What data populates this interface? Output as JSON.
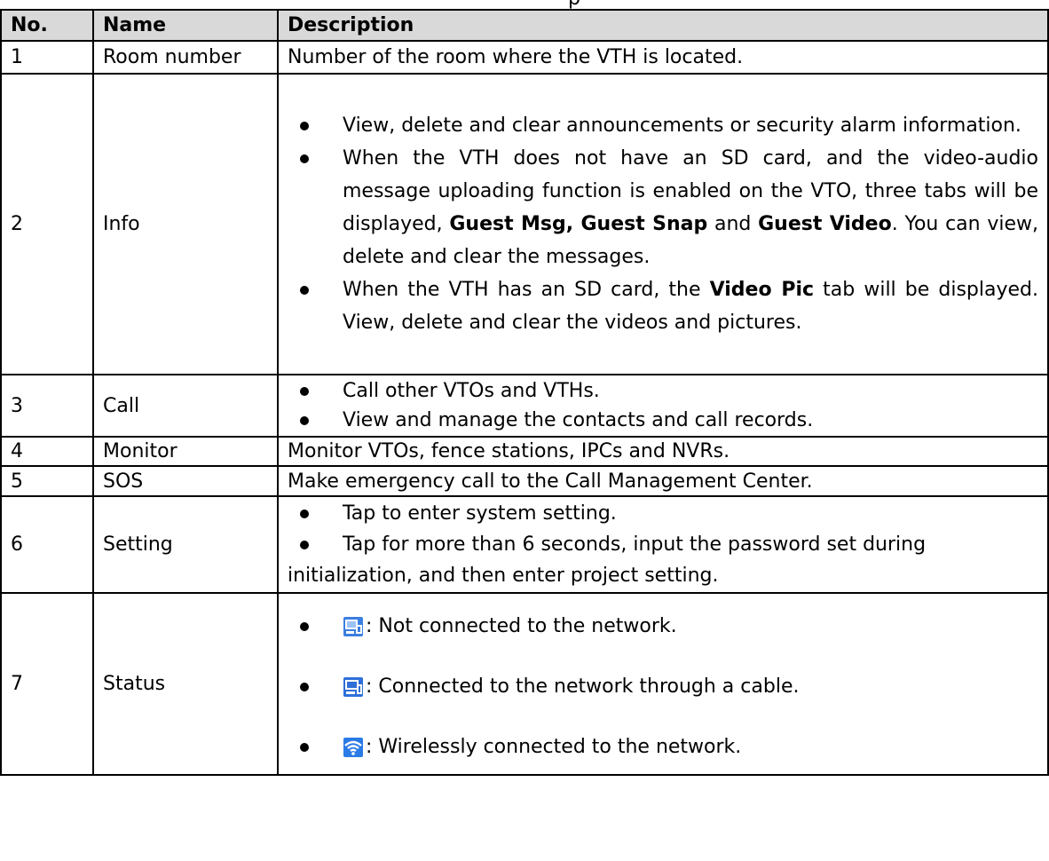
{
  "top_fragment": "p",
  "table": {
    "headers": [
      "No.",
      "Name",
      "Description"
    ],
    "rows": [
      {
        "no": "1",
        "name": "Room number",
        "desc": "Number of the room where the VTH is located."
      },
      {
        "no": "2",
        "name": "Info",
        "bullets": [
          "View, delete and clear announcements or security alarm information.",
          "When the VTH does not have an SD card, and the video-audio message uploading function is enabled on the VTO, three tabs will be displayed, ",
          "When the VTH has an SD card, the "
        ],
        "bold": {
          "guest_msg_snap": "Guest Msg, Guest Snap",
          "and": " and ",
          "guest_video": "Guest Video",
          "after_video": ". You can view, delete and clear the messages.",
          "video_pic": "Video Pic",
          "after_video_pic": " tab will be displayed. View, delete and clear the videos and pictures."
        }
      },
      {
        "no": "3",
        "name": "Call",
        "bullets": [
          "Call other VTOs and VTHs.",
          "View and manage the contacts and call records."
        ]
      },
      {
        "no": "4",
        "name": "Monitor",
        "desc": "Monitor VTOs, fence stations, IPCs and NVRs."
      },
      {
        "no": "5",
        "name": "SOS",
        "desc": "Make emergency call to the Call Management Center."
      },
      {
        "no": "6",
        "name": "Setting",
        "bullet1": "Tap to enter system setting.",
        "bullet2_part1": "Tap for more than 6 seconds, input the password set during",
        "bullet2_part2": "initialization, and then enter project setting."
      },
      {
        "no": "7",
        "name": "Status",
        "status": [
          {
            "icon": "network-disconnected-icon",
            "text": ": Not connected to the network."
          },
          {
            "icon": "network-cable-icon",
            "text": ": Connected to the network through a cable."
          },
          {
            "icon": "wifi-icon",
            "text": ": Wirelessly connected to the network."
          }
        ]
      }
    ]
  },
  "colors": {
    "header_bg": "#d9d9d9",
    "icon_blue": "#1f6fd1",
    "border": "#000000"
  }
}
